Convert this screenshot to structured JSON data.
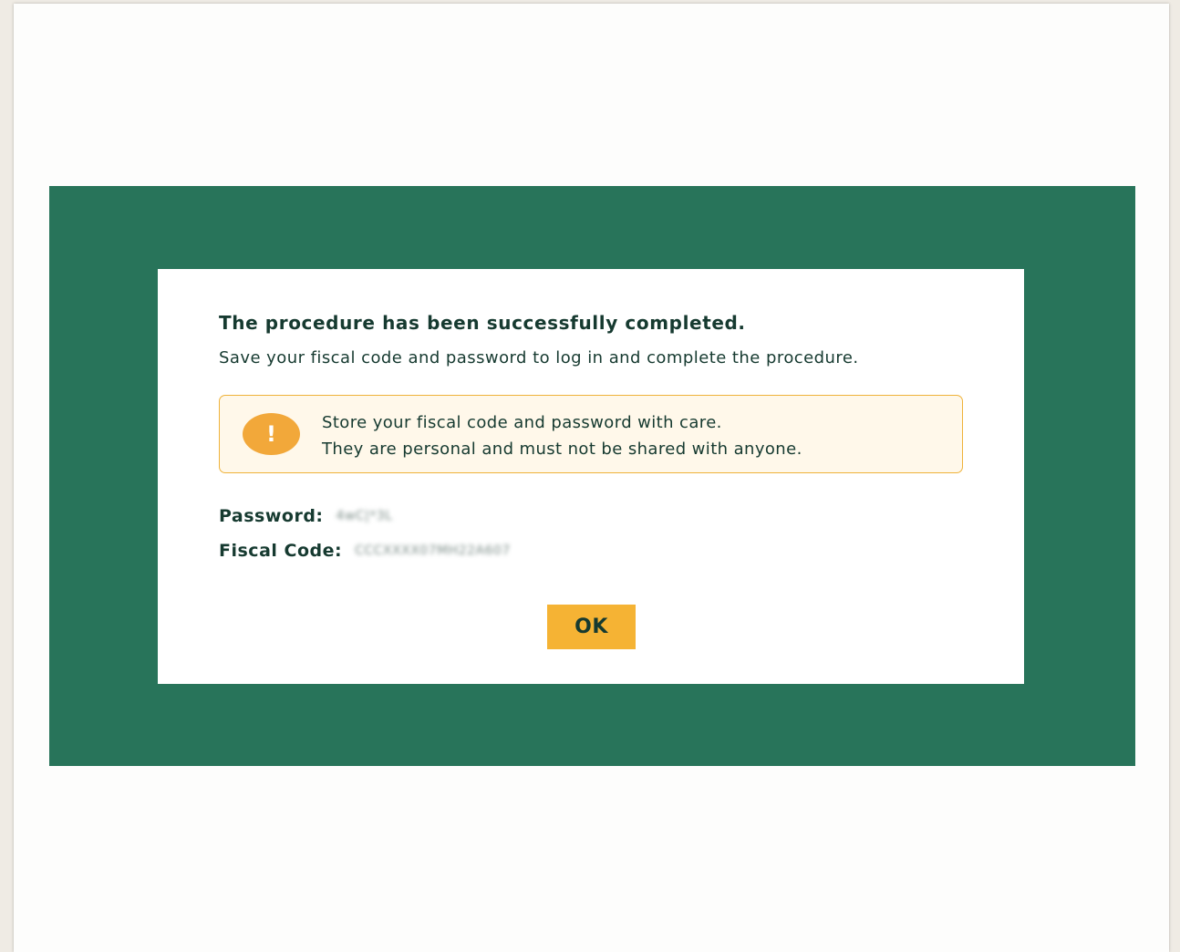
{
  "dialog": {
    "title": "The procedure has been successfully completed.",
    "subtitle": "Save your fiscal code and password to log in and complete the procedure.",
    "alert": {
      "icon": "exclamation-icon",
      "icon_glyph": "!",
      "line1": "Store your fiscal code and password with care.",
      "line2": "They are personal and must not be shared with anyone."
    },
    "password_label": "Password:",
    "password_value": "4wC|*3L",
    "fiscal_code_label": "Fiscal Code:",
    "fiscal_code_value": "CCCXXXX07MH22A607",
    "ok_label": "OK"
  },
  "colors": {
    "backdrop": "#28745a",
    "dialog_text": "#163a30",
    "alert_border": "#efb23a",
    "alert_background": "#fff8ea",
    "alert_icon": "#f2a83a",
    "ok_button": "#f5b334"
  }
}
